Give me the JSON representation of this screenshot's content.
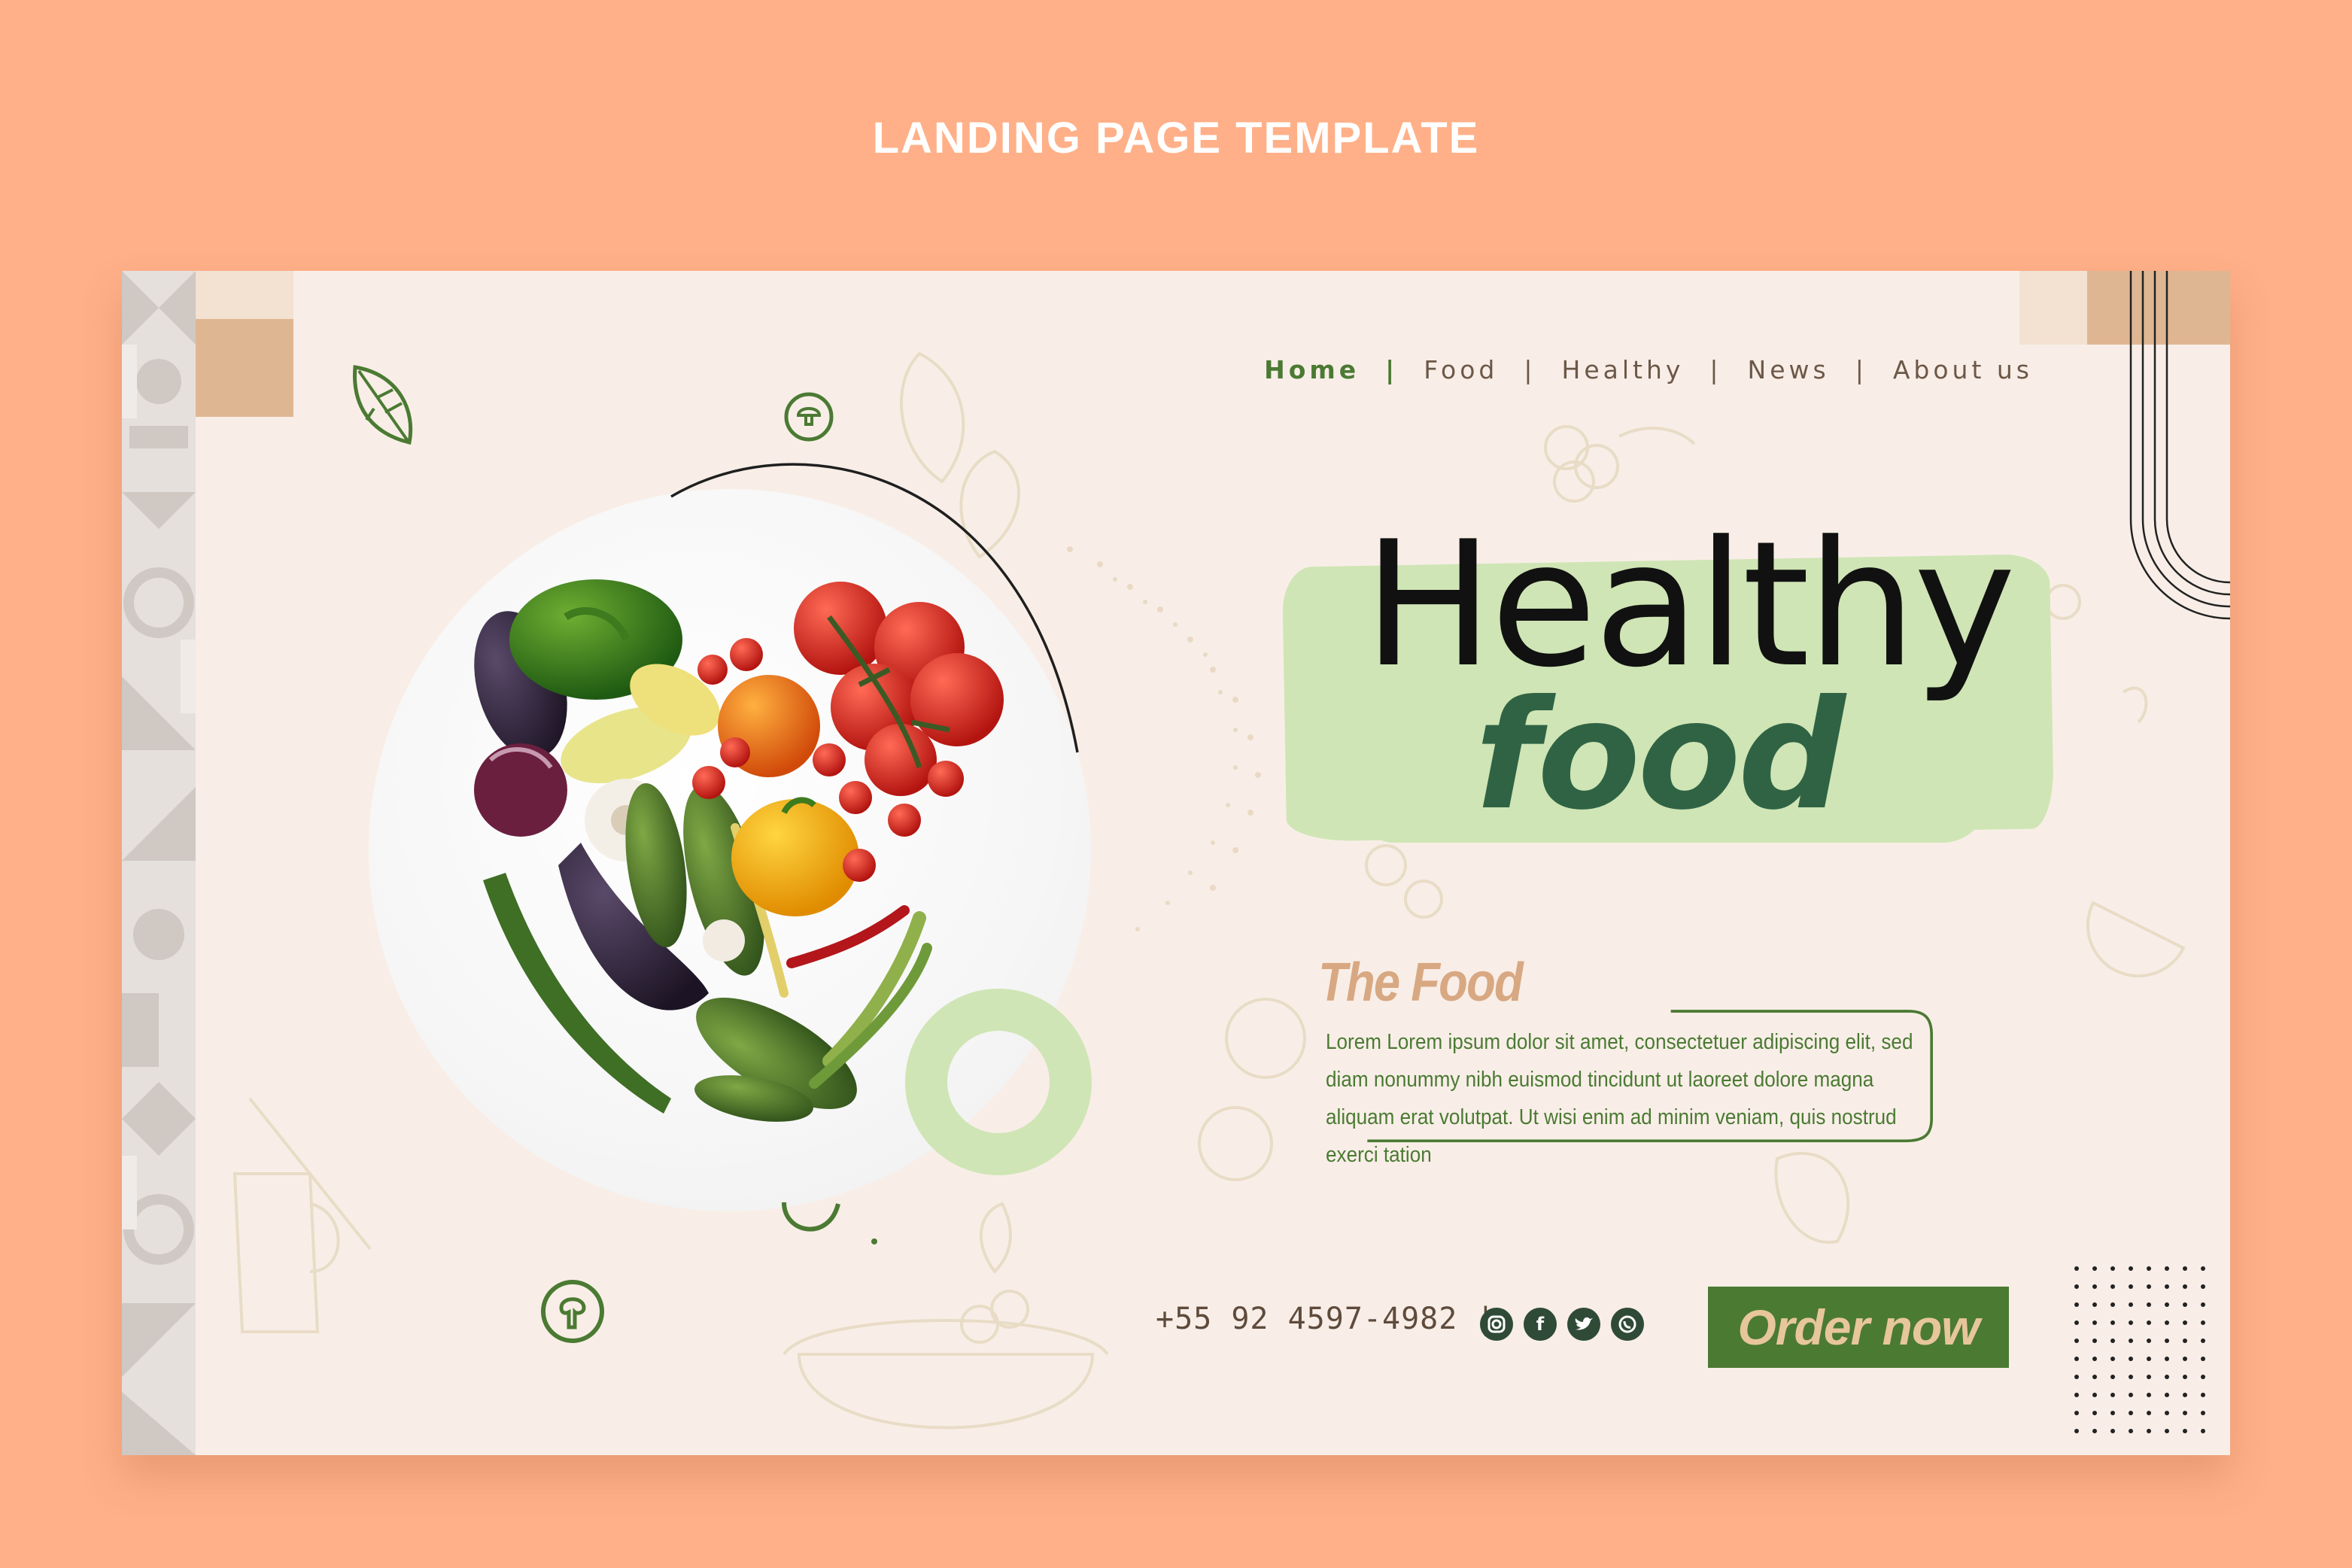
{
  "page_heading": "LANDING PAGE TEMPLATE",
  "nav": {
    "items": [
      "Home",
      "Food",
      "Healthy",
      "News",
      "About us"
    ],
    "separator": "|"
  },
  "hero": {
    "title": "Healthy",
    "subtitle": "food"
  },
  "section": {
    "title": "The Food",
    "description": "Lorem Lorem ipsum dolor sit amet, consectetuer adipiscing elit, sed diam nonummy nibh euismod tincidunt ut laoreet dolore magna aliquam erat volutpat. Ut wisi enim ad minim veniam, quis nostrud exerci tation"
  },
  "contact": {
    "phone": "+55 92 4597-4982 |"
  },
  "social_icons": [
    "instagram-icon",
    "facebook-icon",
    "twitter-icon",
    "whatsapp-icon"
  ],
  "cta": {
    "order_label": "Order now"
  },
  "colors": {
    "background": "#ffb088",
    "card": "#f8eee7",
    "accent_green": "#4b7a33",
    "dark_green": "#2f6344",
    "light_green": "#cfe5b5",
    "tan": "#d8a882"
  }
}
